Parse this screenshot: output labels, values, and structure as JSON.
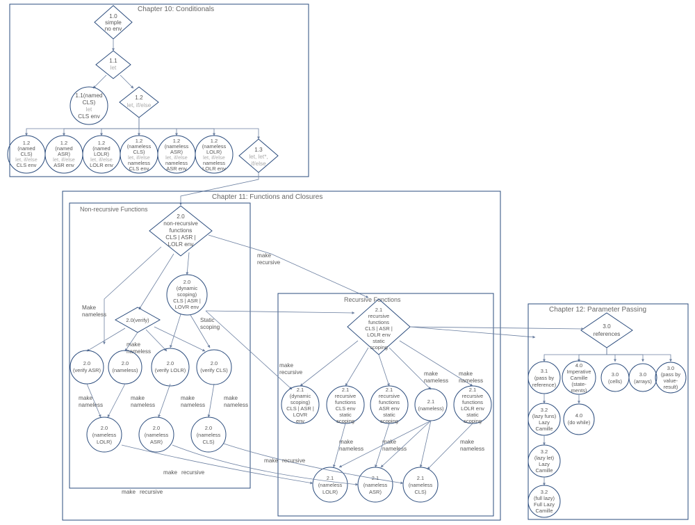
{
  "ch10": {
    "title": "Chapter 10: Conditionals",
    "n10": {
      "l1": "1.0",
      "l2": "simple",
      "l3": "no env"
    },
    "n11": {
      "l1": "1.1",
      "l2": "let"
    },
    "n11named": {
      "l1": "1.1(named",
      "l2": "CLS)",
      "l3": "let",
      "l4": "CLS env"
    },
    "n12": {
      "l1": "1.2",
      "l2": "let, if/else"
    },
    "n13": {
      "l1": "1.3",
      "l2": "let, let*,",
      "l3": "if/else"
    },
    "row": {
      "l1": "1.2"
    },
    "r0": {
      "v": "(named",
      "env": "CLS)",
      "s": "let, if/else",
      "e": "CLS env"
    },
    "r1": {
      "v": "(named",
      "env": "ASR)",
      "s": "let, if/else",
      "e": "ASR env"
    },
    "r2": {
      "v": "(named",
      "env": "LOLR)",
      "s": "let, if/else",
      "e": "LOLR env"
    },
    "r3": {
      "v": "(nameless",
      "env": "CLS)",
      "s": "let, if/else",
      "e": "nameless",
      "e2": "CLS env"
    },
    "r4": {
      "v": "(nameless",
      "env": "ASR)",
      "s": "let, if/else",
      "e": "nameless",
      "e2": "ASR env"
    },
    "r5": {
      "v": "(nameless",
      "env": "LOLR)",
      "s": "let, if/else",
      "e": "nameless",
      "e2": "LOLR env"
    }
  },
  "ch11": {
    "title": "Chapter 11: Functions and Closures",
    "box_nr": "Non-recursive Functions",
    "box_r": "Recursive Functions",
    "n20": {
      "l1": "2.0",
      "l2": "non-recursive",
      "l3": "functions",
      "l4": "CLS | ASR |",
      "l5": "LOLR env"
    },
    "n20v": {
      "l1": "2.0(verify)"
    },
    "n20dyn": {
      "l1": "2.0",
      "l2": "(dynamic",
      "l3": "scoping)",
      "l4": "CLS | ASR |",
      "l5": "LOVR env"
    },
    "e_make_nameless": "Make",
    "e_make_nameless2": "nameless",
    "e_static": "Static",
    "e_static2": "scoping",
    "e_make_rec": "make",
    "e_make_rec2": "recursive",
    "e_mn": "make",
    "e_mn2": "nameless",
    "c_vasr": {
      "l1": "2.0",
      "l2": "(verify ASR)"
    },
    "c_nls": {
      "l1": "2.0",
      "l2": "(nameless)"
    },
    "c_vlolr": {
      "l1": "2.0",
      "l2": "(verify LOLR)"
    },
    "c_vcls": {
      "l1": "2.0",
      "l2": "(verify CLS)"
    },
    "c_nlolr": {
      "l1": "2.0",
      "l2": "(nameless",
      "l3": "LOLR)"
    },
    "c_nasr": {
      "l1": "2.0",
      "l2": "(nameless",
      "l3": "ASR)"
    },
    "c_ncls": {
      "l1": "2.0",
      "l2": "(nameless",
      "l3": "CLS)"
    },
    "n21": {
      "l1": "2.1",
      "l2": "recursive",
      "l3": "functions",
      "l4": "CLS | ASR |",
      "l5": "LOLR env",
      "l6": "static",
      "l7": "scoping"
    },
    "r_dyn": {
      "l1": "2.1",
      "l2": "(dynamic",
      "l3": "scoping)",
      "l4": "CLS | ASR |",
      "l5": "LOVR",
      "l6": "env"
    },
    "r_cls": {
      "l1": "2.1",
      "l2": "recursive",
      "l3": "functions",
      "l4": "CLS env",
      "l5": "static",
      "l6": "scoping"
    },
    "r_asr": {
      "l1": "2.1",
      "l2": "recursive",
      "l3": "functions",
      "l4": "ASR env",
      "l5": "static",
      "l6": "scoping"
    },
    "r_nm": {
      "l1": "2.1",
      "l2": "(nameless)"
    },
    "r_lolr": {
      "l1": "2.1",
      "l2": "recursive",
      "l3": "functions",
      "l4": "LOLR env",
      "l5": "static",
      "l6": "scoping"
    },
    "rn_lolr": {
      "l1": "2.1",
      "l2": "(nameless",
      "l3": "LOLR)"
    },
    "rn_asr": {
      "l1": "2.1",
      "l2": "(nameless",
      "l3": "ASR)"
    },
    "rn_cls": {
      "l1": "2.1",
      "l2": "(nameless",
      "l3": "CLS)"
    }
  },
  "ch12": {
    "title": "Chapter 12: Parameter Passing",
    "n30": {
      "l1": "3.0",
      "l2": "references"
    },
    "c_ref": {
      "l1": "3.1",
      "l2": "(pass by",
      "l3": "reference)"
    },
    "c_imp": {
      "l1": "4.0",
      "l2": "Imperative",
      "l3": "Camille",
      "l4": "(state-",
      "l5": "ments)"
    },
    "c_cells": {
      "l1": "3.0",
      "l2": "(cells)"
    },
    "c_arr": {
      "l1": "3.0",
      "l2": "(arrays)"
    },
    "c_pvr": {
      "l1": "3.0",
      "l2": "(pass by",
      "l3": "value-",
      "l4": "result)"
    },
    "c_lazyf": {
      "l1": "3.2",
      "l2": "(lazy funs)",
      "l3": "Lazy",
      "l4": "Camille"
    },
    "c_dw": {
      "l1": "4.0",
      "l2": "(do while)"
    },
    "c_lazyl": {
      "l1": "3.2",
      "l2": "(lazy let)",
      "l3": "Lazy",
      "l4": "Camille"
    },
    "c_full": {
      "l1": "3.2",
      "l2": "(full lazy)",
      "l3": "Full Lazy",
      "l4": "Camille"
    }
  }
}
